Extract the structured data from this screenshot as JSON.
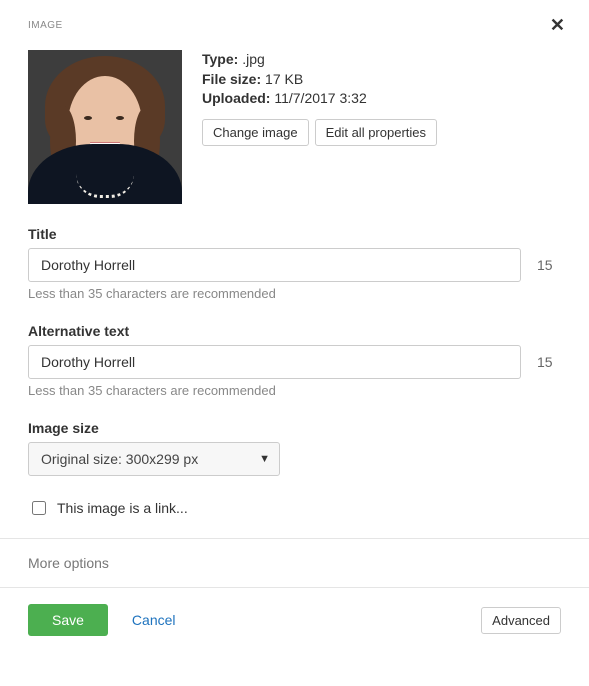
{
  "header": {
    "title": "IMAGE"
  },
  "meta": {
    "type_label": "Type:",
    "type_value": ".jpg",
    "filesize_label": "File size:",
    "filesize_value": "17 KB",
    "uploaded_label": "Uploaded:",
    "uploaded_value": "11/7/2017 3:32",
    "change_image": "Change image",
    "edit_all": "Edit all properties"
  },
  "title_field": {
    "label": "Title",
    "value": "Dorothy Horrell",
    "count": "15",
    "hint": "Less than 35 characters are recommended"
  },
  "alt_field": {
    "label": "Alternative text",
    "value": "Dorothy Horrell",
    "count": "15",
    "hint": "Less than 35 characters are recommended"
  },
  "size_field": {
    "label": "Image size",
    "value": "Original size: 300x299 px"
  },
  "link_checkbox": {
    "label": "This image is a link..."
  },
  "more_options": "More options",
  "footer": {
    "save": "Save",
    "cancel": "Cancel",
    "advanced": "Advanced"
  }
}
